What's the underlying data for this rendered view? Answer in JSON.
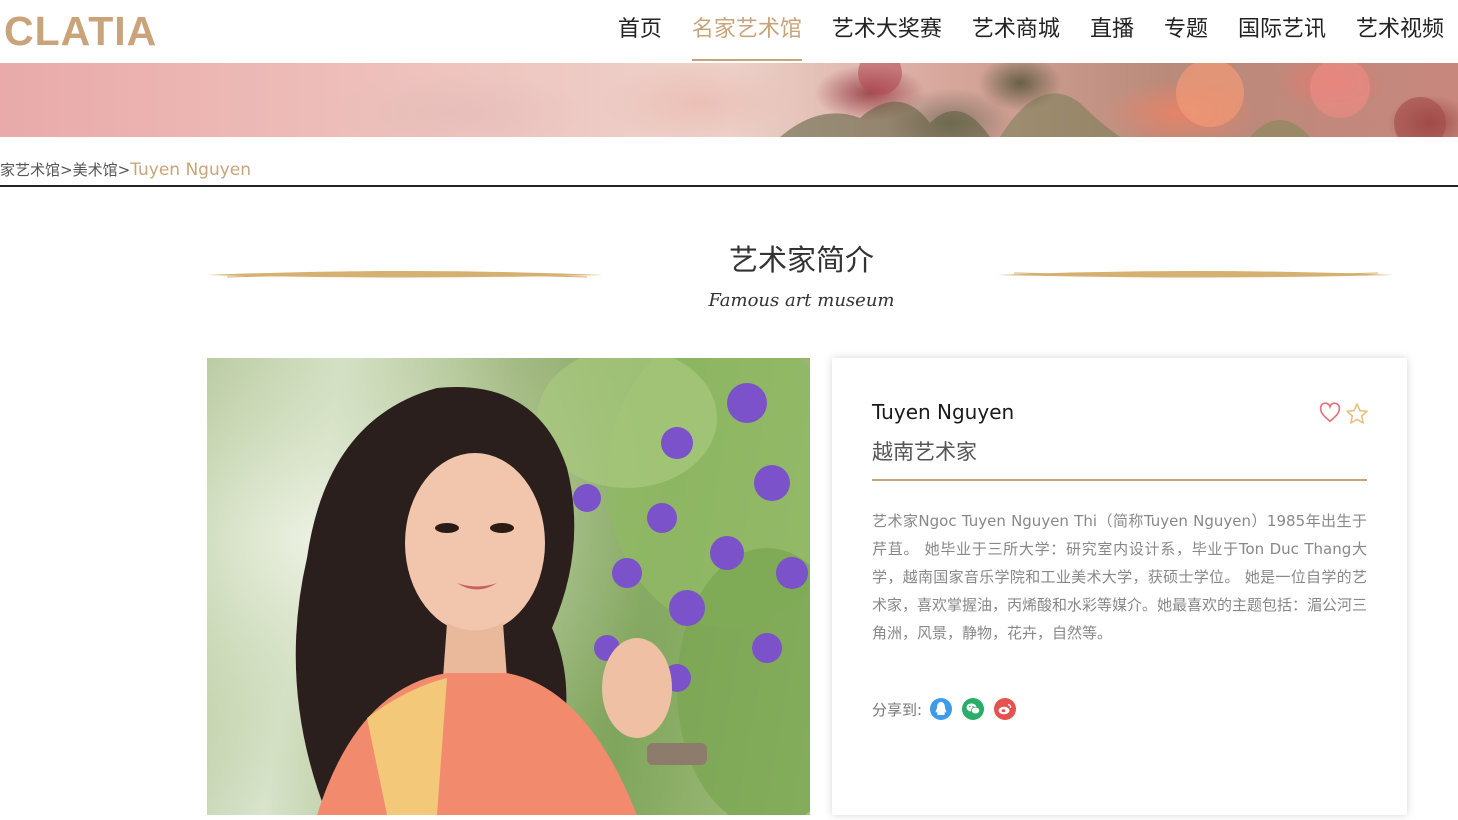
{
  "header": {
    "logo_text": "CLATIA",
    "nav": [
      {
        "label": "首页",
        "active": false
      },
      {
        "label": "名家艺术馆",
        "active": true
      },
      {
        "label": "艺术大奖赛",
        "active": false
      },
      {
        "label": "艺术商城",
        "active": false
      },
      {
        "label": "直播",
        "active": false
      },
      {
        "label": "专题",
        "active": false
      },
      {
        "label": "国际艺讯",
        "active": false
      },
      {
        "label": "艺术视频",
        "active": false
      }
    ]
  },
  "breadcrumb": {
    "items": [
      "家艺术馆",
      "美术馆"
    ],
    "separator": ">",
    "current": "Tuyen Nguyen"
  },
  "section": {
    "title": "艺术家简介",
    "subtitle": "Famous art museum"
  },
  "artist": {
    "name": "Tuyen Nguyen",
    "subtitle": "越南艺术家",
    "bio": "艺术家Ngoc Tuyen Nguyen Thi（简称Tuyen Nguyen）1985年出生于芹苴。 她毕业于三所大学：研究室内设计系，毕业于Ton Duc Thang大学，越南国家音乐学院和工业美术大学，获硕士学位。 她是一位自学的艺术家，喜欢掌握油，丙烯酸和水彩等媒介。她最喜欢的主题包括：湄公河三角洲，风景，静物，花卉，自然等。",
    "share_label": "分享到:"
  },
  "colors": {
    "accent": "#c9a47b",
    "qq": "#3d9be9",
    "wechat": "#2aae67",
    "weibo": "#e5524f",
    "heart": "#e0737a",
    "star": "#e5c27a"
  },
  "icons": [
    "heart-icon",
    "star-icon",
    "qq-icon",
    "wechat-icon",
    "weibo-icon"
  ]
}
